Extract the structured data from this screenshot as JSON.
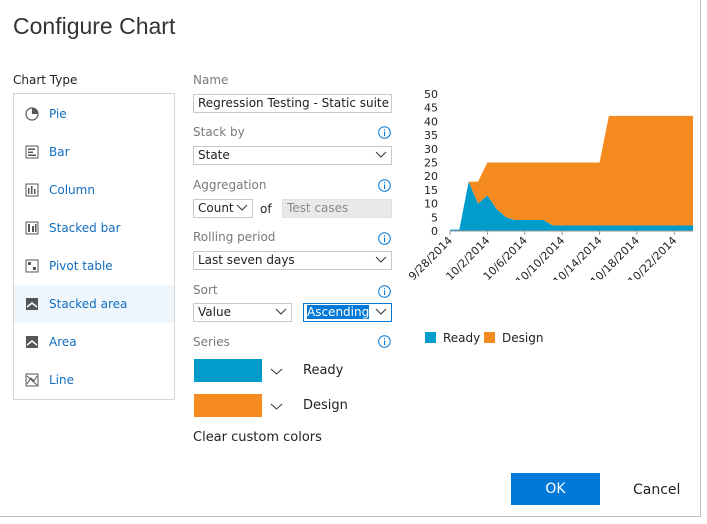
{
  "dialog": {
    "title": "Configure Chart"
  },
  "chart_type": {
    "heading": "Chart Type",
    "items": [
      {
        "label": "Pie",
        "icon": "pie-chart-icon"
      },
      {
        "label": "Bar",
        "icon": "bar-chart-icon"
      },
      {
        "label": "Column",
        "icon": "column-chart-icon"
      },
      {
        "label": "Stacked bar",
        "icon": "stacked-bar-icon"
      },
      {
        "label": "Pivot table",
        "icon": "pivot-table-icon"
      },
      {
        "label": "Stacked area",
        "icon": "stacked-area-icon",
        "selected": true
      },
      {
        "label": "Area",
        "icon": "area-chart-icon"
      },
      {
        "label": "Line",
        "icon": "line-chart-icon"
      }
    ]
  },
  "form": {
    "name_label": "Name",
    "name_value": "Regression Testing - Static suite - Ch",
    "stack_by_label": "Stack by",
    "stack_by_value": "State",
    "aggregation_label": "Aggregation",
    "aggregation_value": "Count",
    "of_label": "of",
    "aggregation_target": "Test cases",
    "rolling_label": "Rolling period",
    "rolling_value": "Last seven days",
    "sort_label": "Sort",
    "sort_by_value": "Value",
    "sort_order_value": "Ascending",
    "series_label": "Series",
    "series": [
      {
        "name": "Ready",
        "color": "#009ccc"
      },
      {
        "name": "Design",
        "color": "#f58b1f"
      }
    ],
    "clear_colors": "Clear custom colors"
  },
  "buttons": {
    "ok": "OK",
    "cancel": "Cancel"
  },
  "colors": {
    "accent": "#0078d7",
    "link": "#106ebe"
  },
  "chart_data": {
    "type": "area",
    "stacked": true,
    "x": [
      "9/28/2014",
      "9/29/2014",
      "9/30/2014",
      "10/1/2014",
      "10/2/2014",
      "10/3/2014",
      "10/4/2014",
      "10/5/2014",
      "10/6/2014",
      "10/7/2014",
      "10/8/2014",
      "10/9/2014",
      "10/10/2014",
      "10/11/2014",
      "10/12/2014",
      "10/13/2014",
      "10/14/2014",
      "10/15/2014",
      "10/16/2014",
      "10/17/2014",
      "10/18/2014",
      "10/19/2014",
      "10/20/2014",
      "10/21/2014",
      "10/22/2014",
      "10/23/2014",
      "10/24/2014"
    ],
    "xticks": [
      "9/28/2014",
      "10/2/2014",
      "10/6/2014",
      "10/10/2014",
      "10/14/2014",
      "10/18/2014",
      "10/22/2014"
    ],
    "yticks": [
      "0",
      "5",
      "10",
      "15",
      "20",
      "25",
      "30",
      "35",
      "40",
      "45",
      "50"
    ],
    "ylim": [
      0,
      50
    ],
    "series": [
      {
        "name": "Ready",
        "color": "#009ccc",
        "values": [
          0.5,
          0.5,
          18,
          10,
          13,
          8,
          5,
          4,
          4,
          4,
          4,
          2,
          2,
          2,
          2,
          2,
          2,
          2,
          2,
          2,
          2,
          2,
          2,
          2,
          2,
          2,
          2
        ]
      },
      {
        "name": "Design",
        "color": "#f58b1f",
        "values": [
          0,
          0,
          0,
          8,
          12,
          17,
          20,
          21,
          21,
          21,
          21,
          23,
          23,
          23,
          23,
          23,
          23,
          40,
          40,
          40,
          40,
          40,
          40,
          40,
          40,
          40,
          40
        ]
      }
    ],
    "legend_position": "bottom-left",
    "grid": false
  }
}
